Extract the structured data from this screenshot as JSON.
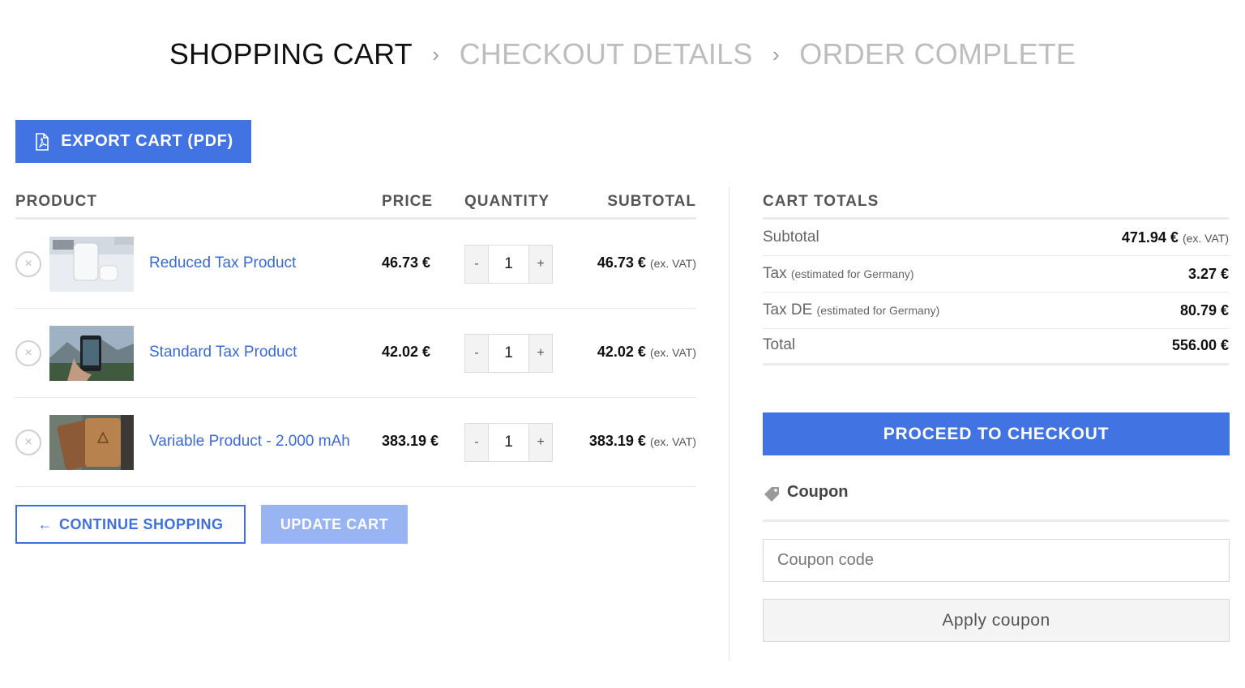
{
  "breadcrumb": {
    "step1": "SHOPPING CART",
    "step2": "CHECKOUT DETAILS",
    "step3": "ORDER COMPLETE",
    "separator": "›"
  },
  "export_button": {
    "label": "EXPORT CART (PDF)",
    "icon": "pdf-file-icon"
  },
  "table": {
    "headers": {
      "product": "PRODUCT",
      "price": "PRICE",
      "quantity": "QUANTITY",
      "subtotal": "SUBTOTAL"
    },
    "items": [
      {
        "name": "Reduced Tax Product",
        "price": "46.73 €",
        "qty": "1",
        "subtotal": "46.73 €",
        "vat_note": "(ex. VAT)",
        "image": "earbuds-on-desk"
      },
      {
        "name": "Standard Tax Product",
        "price": "42.02 €",
        "qty": "1",
        "subtotal": "42.02 €",
        "vat_note": "(ex. VAT)",
        "image": "phone-in-hand-mountains"
      },
      {
        "name": "Variable Product - 2.000 mAh",
        "price": "383.19 €",
        "qty": "1",
        "subtotal": "383.19 €",
        "vat_note": "(ex. VAT)",
        "image": "leather-wallet"
      }
    ],
    "remove_symbol": "×",
    "minus": "-",
    "plus": "+"
  },
  "actions": {
    "continue_shopping": "CONTINUE SHOPPING",
    "continue_arrow": "←",
    "update_cart": "UPDATE CART"
  },
  "totals": {
    "title": "CART TOTALS",
    "subtotal_label": "Subtotal",
    "subtotal_value": "471.94 €",
    "subtotal_note": "(ex. VAT)",
    "tax_label": "Tax",
    "tax_note": "(estimated for Germany)",
    "tax_value": "3.27 €",
    "taxde_label": "Tax DE",
    "taxde_note": "(estimated for Germany)",
    "taxde_value": "80.79 €",
    "total_label": "Total",
    "total_value": "556.00 €"
  },
  "checkout_button": "PROCEED TO CHECKOUT",
  "coupon": {
    "heading": "Coupon",
    "placeholder": "Coupon code",
    "apply": "Apply coupon"
  },
  "colors": {
    "accent": "#4273e3",
    "accent_light": "#98b4f3",
    "link": "#3a6bd8"
  }
}
